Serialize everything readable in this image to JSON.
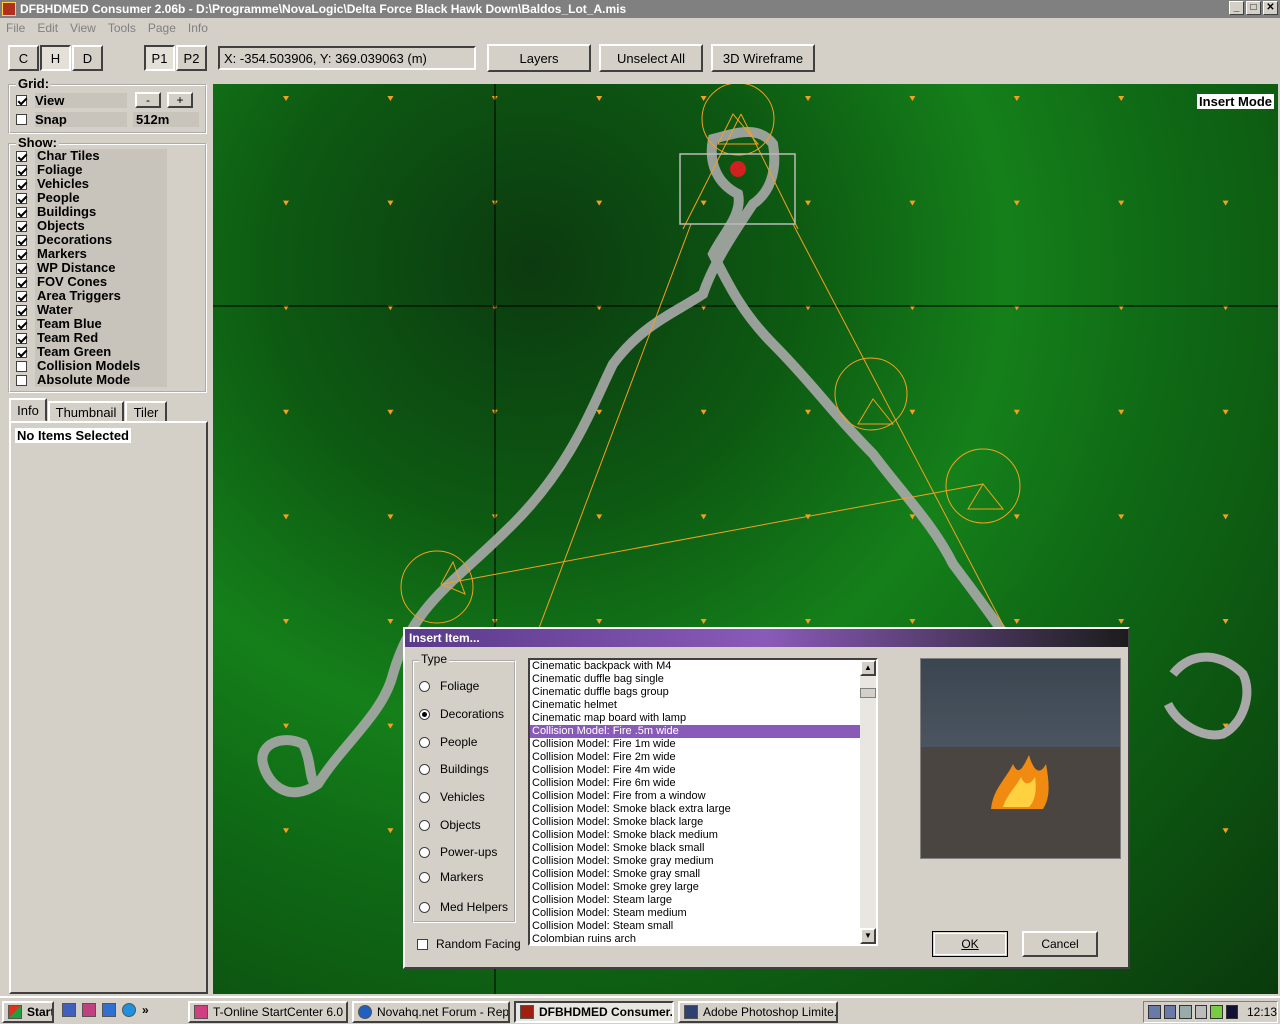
{
  "window": {
    "title": "DFBHDMED Consumer 2.06b - D:\\Programme\\NovaLogic\\Delta Force Black Hawk Down\\Baldos_Lot_A.mis",
    "min": "_",
    "max": "□",
    "close": "✕"
  },
  "menu": [
    "File",
    "Edit",
    "View",
    "Tools",
    "Page",
    "Info"
  ],
  "toolbar": {
    "mode_buttons": [
      "C",
      "H",
      "D"
    ],
    "page_buttons": [
      "P1",
      "P2"
    ],
    "coords": "X: -354.503906, Y: 369.039063 (m)",
    "layers": "Layers",
    "unselect_all": "Unselect All",
    "wireframe": "3D Wireframe"
  },
  "grid": {
    "title": "Grid:",
    "view_label": "View",
    "view_checked": true,
    "minus": "-",
    "plus": "+",
    "snap_label": "Snap",
    "snap_checked": false,
    "snap_value": "512m"
  },
  "show": {
    "title": "Show:",
    "items": [
      {
        "label": "Char Tiles",
        "checked": true
      },
      {
        "label": "Foliage",
        "checked": true
      },
      {
        "label": "Vehicles",
        "checked": true
      },
      {
        "label": "People",
        "checked": true
      },
      {
        "label": "Buildings",
        "checked": true
      },
      {
        "label": "Objects",
        "checked": true
      },
      {
        "label": "Decorations",
        "checked": true
      },
      {
        "label": "Markers",
        "checked": true
      },
      {
        "label": "WP Distance",
        "checked": true
      },
      {
        "label": "FOV Cones",
        "checked": true
      },
      {
        "label": "Area Triggers",
        "checked": true
      },
      {
        "label": "Water",
        "checked": true
      },
      {
        "label": "Team Blue",
        "checked": true
      },
      {
        "label": "Team Red",
        "checked": true
      },
      {
        "label": "Team Green",
        "checked": true
      },
      {
        "label": "Collision Models",
        "checked": false
      },
      {
        "label": "Absolute Mode",
        "checked": false
      }
    ]
  },
  "tabs": [
    "Info",
    "Thumbnail",
    "Tiler"
  ],
  "info_text": "No Items Selected",
  "map": {
    "mode_label": "Insert Mode"
  },
  "dialog": {
    "title": "Insert Item...",
    "type_title": "Type",
    "types": [
      {
        "label": "Foliage",
        "selected": false
      },
      {
        "label": "Decorations",
        "selected": true
      },
      {
        "label": "People",
        "selected": false
      },
      {
        "label": "Buildings",
        "selected": false
      },
      {
        "label": "Vehicles",
        "selected": false
      },
      {
        "label": "Objects",
        "selected": false
      },
      {
        "label": "Power-ups",
        "selected": false
      },
      {
        "label": "Markers",
        "selected": false
      },
      {
        "label": "Med Helpers",
        "selected": false
      }
    ],
    "random_facing": "Random Facing",
    "items": [
      "Cinematic backpack with M4",
      "Cinematic duffle bag single",
      "Cinematic duffle bags group",
      "Cinematic helmet",
      "Cinematic map board with lamp",
      "Collision Model: Fire .5m wide",
      "Collision Model: Fire 1m wide",
      "Collision Model: Fire 2m wide",
      "Collision Model: Fire 4m wide",
      "Collision Model: Fire 6m wide",
      "Collision Model: Fire from a window",
      "Collision Model: Smoke black extra large",
      "Collision Model: Smoke black large",
      "Collision Model: Smoke black medium",
      "Collision Model: Smoke black small",
      "Collision Model: Smoke gray medium",
      "Collision Model: Smoke gray small",
      "Collision Model: Smoke grey large",
      "Collision Model: Steam large",
      "Collision Model: Steam medium",
      "Collision Model: Steam small",
      "Colombian ruins arch"
    ],
    "selected_index": 5,
    "ok": "OK",
    "cancel": "Cancel"
  },
  "taskbar": {
    "start": "Start",
    "tasks": [
      {
        "label": "T-Online StartCenter 6.0",
        "active": false
      },
      {
        "label": "Novahq.net Forum - Rep...",
        "active": false
      },
      {
        "label": "DFBHDMED Consumer...",
        "active": true
      },
      {
        "label": "Adobe Photoshop Limite...",
        "active": false
      }
    ],
    "clock": "12:13"
  }
}
